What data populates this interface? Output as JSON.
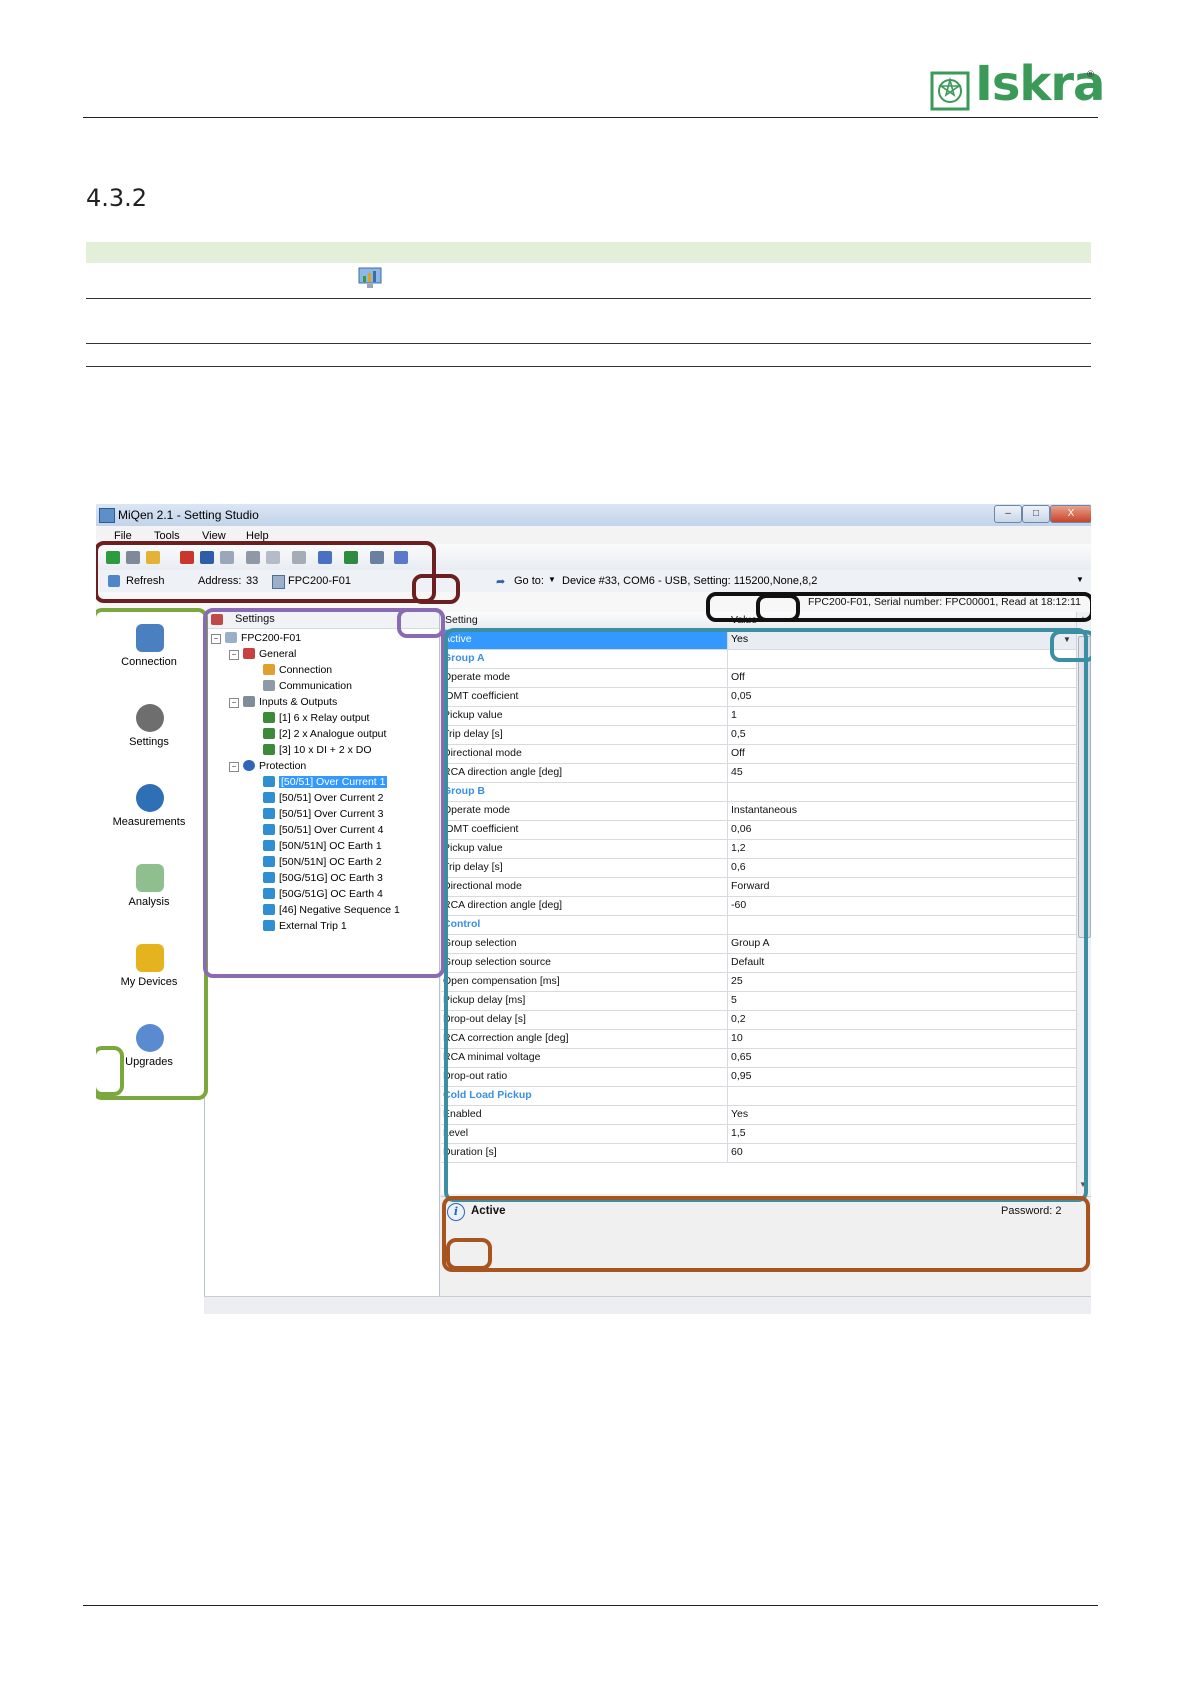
{
  "page": {
    "logo_text": "Iskra",
    "logo_reg": "®",
    "section_number": "4.3.2"
  },
  "window": {
    "title": "MiQen 2.1 - Setting Studio",
    "buttons": {
      "minimize": "–",
      "maximize": "□",
      "close": "X"
    },
    "menu": [
      "File",
      "Tools",
      "View",
      "Help"
    ],
    "refresh_label": "Refresh",
    "address_label": "Address:",
    "address_value": "33",
    "device_name": "FPC200-F01",
    "goto_label": "Go to:",
    "device_info": "Device #33, COM6 - USB, Setting: 115200,None,8,2",
    "serial_line": "FPC200-F01, Serial number: FPC00001, Read at 18:12:11"
  },
  "nav": {
    "items": [
      {
        "label": "Connection",
        "icon": "connection-icon",
        "color": "#4a7fc0"
      },
      {
        "label": "Settings",
        "icon": "settings-gear-icon",
        "color": "#6e6e6e"
      },
      {
        "label": "Measurements",
        "icon": "gauge-icon",
        "color": "#2f6fb5"
      },
      {
        "label": "Analysis",
        "icon": "analysis-chart-icon",
        "color": "#4c9f4c"
      },
      {
        "label": "My Devices",
        "icon": "star-folder-icon",
        "color": "#e5b31e"
      },
      {
        "label": "Upgrades",
        "icon": "upgrade-disc-icon",
        "color": "#5a8bd0"
      }
    ]
  },
  "tree": {
    "header": "Settings",
    "root": "FPC200-F01",
    "general": "General",
    "connection": "Connection",
    "communication": "Communication",
    "io": "Inputs & Outputs",
    "relay": "[1] 6 x Relay output",
    "analogue": "[2] 2 x Analogue output",
    "dido": "[3] 10 x DI + 2 x DO",
    "protection": "Protection",
    "prot_items": [
      "[50/51] Over Current 1",
      "[50/51] Over Current 2",
      "[50/51] Over Current 3",
      "[50/51] Over Current 4",
      "[50N/51N] OC Earth 1",
      "[50N/51N] OC Earth 2",
      "[50G/51G] OC Earth 3",
      "[50G/51G] OC Earth 4",
      "[46] Negative Sequence 1",
      "External Trip 1"
    ]
  },
  "grid": {
    "col_setting": "Setting",
    "col_value": "Value",
    "rows": [
      {
        "setting": "Active",
        "value": "Yes",
        "kind": "active"
      },
      {
        "setting": "Group A",
        "value": "",
        "kind": "group"
      },
      {
        "setting": "Operate mode",
        "value": "Off",
        "kind": ""
      },
      {
        "setting": "IDMT coefficient",
        "value": "0,05",
        "kind": ""
      },
      {
        "setting": "Pickup value",
        "value": "1",
        "kind": ""
      },
      {
        "setting": "Trip delay [s]",
        "value": "0,5",
        "kind": ""
      },
      {
        "setting": "Directional mode",
        "value": "Off",
        "kind": ""
      },
      {
        "setting": "RCA direction angle [deg]",
        "value": "45",
        "kind": ""
      },
      {
        "setting": "Group B",
        "value": "",
        "kind": "group"
      },
      {
        "setting": "Operate mode",
        "value": "Instantaneous",
        "kind": ""
      },
      {
        "setting": "IDMT coefficient",
        "value": "0,06",
        "kind": ""
      },
      {
        "setting": "Pickup value",
        "value": "1,2",
        "kind": ""
      },
      {
        "setting": "Trip delay [s]",
        "value": "0,6",
        "kind": ""
      },
      {
        "setting": "Directional mode",
        "value": "Forward",
        "kind": ""
      },
      {
        "setting": "RCA direction angle [deg]",
        "value": "-60",
        "kind": ""
      },
      {
        "setting": "Control",
        "value": "",
        "kind": "group"
      },
      {
        "setting": "Group selection",
        "value": "Group A",
        "kind": ""
      },
      {
        "setting": "Group selection source",
        "value": "Default",
        "kind": ""
      },
      {
        "setting": "Open compensation [ms]",
        "value": "25",
        "kind": ""
      },
      {
        "setting": "Pickup delay [ms]",
        "value": "5",
        "kind": ""
      },
      {
        "setting": "Drop-out delay [s]",
        "value": "0,2",
        "kind": ""
      },
      {
        "setting": "RCA correction angle [deg]",
        "value": "10",
        "kind": ""
      },
      {
        "setting": "RCA minimal voltage",
        "value": "0,65",
        "kind": ""
      },
      {
        "setting": "Drop-out ratio",
        "value": "0,95",
        "kind": ""
      },
      {
        "setting": "Cold Load Pickup",
        "value": "",
        "kind": "group"
      },
      {
        "setting": "Enabled",
        "value": "Yes",
        "kind": ""
      },
      {
        "setting": "Level",
        "value": "1,5",
        "kind": ""
      },
      {
        "setting": "Duration [s]",
        "value": "60",
        "kind": ""
      }
    ]
  },
  "info": {
    "icon": "i",
    "title": "Active",
    "password": "Password: 2"
  },
  "colors": {
    "logo_green": "#3b9a58",
    "selection_blue": "#3399ff",
    "group_text": "#3a8ee6",
    "annotation_toolbar": "#6b1f1f",
    "annotation_nav": "#7aa83c",
    "annotation_tree": "#8a6bb3",
    "annotation_status": "#111111",
    "annotation_grid": "#3c8ea3",
    "annotation_info": "#a8541f"
  }
}
